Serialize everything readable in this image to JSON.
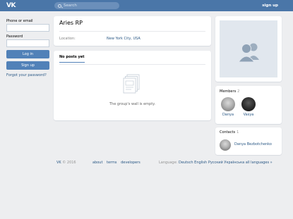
{
  "header": {
    "logo": "VK",
    "search_placeholder": "Search",
    "signup_label": "sign up",
    "colors": {
      "bar": "#4a76a8",
      "accent": "#5181b8",
      "link": "#2a5885"
    }
  },
  "login": {
    "phone_label": "Phone or email",
    "password_label": "Password",
    "login_button": "Log in",
    "signup_button": "Sign up",
    "forgot_link": "Forgot your password?"
  },
  "group": {
    "name": "Aries RP",
    "location_label": "Location:",
    "location_value": "New York City, USA"
  },
  "wall": {
    "tab_label": "No posts yet",
    "empty_text": "The group's wall is empty."
  },
  "members": {
    "title": "Members",
    "count": "2",
    "items": [
      {
        "name": "Danya",
        "icon": "avatar-photo"
      },
      {
        "name": "Vasya",
        "icon": "avatar-photo"
      }
    ]
  },
  "contacts": {
    "title": "Contacts",
    "count": "1",
    "items": [
      {
        "name": "Danya Bezbotchenko",
        "icon": "avatar-photo"
      }
    ]
  },
  "footer": {
    "brand": "VK",
    "copyright": "© 2016",
    "links": [
      "about",
      "terms",
      "developers"
    ],
    "language_label": "Language:",
    "languages": [
      "Deutsch",
      "English",
      "Русский",
      "Українська",
      "all languages »"
    ]
  }
}
